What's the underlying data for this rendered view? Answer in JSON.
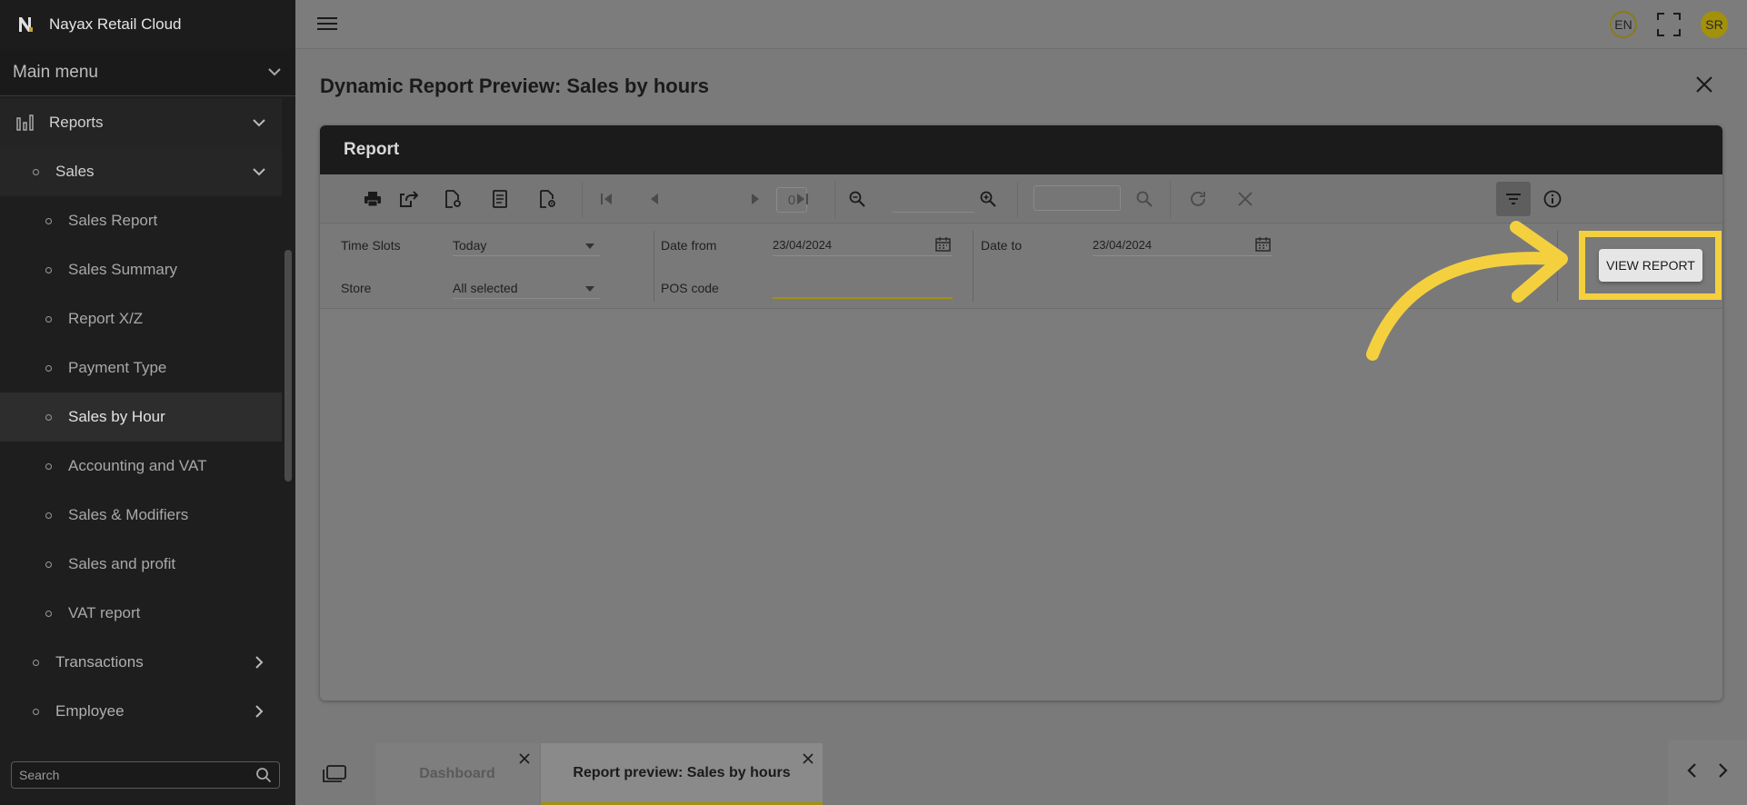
{
  "app": {
    "title": "Nayax Retail Cloud"
  },
  "sidebar": {
    "main_menu_label": "Main menu",
    "reports_label": "Reports",
    "sales_label": "Sales",
    "sales_items": [
      "Sales Report",
      "Sales Summary",
      "Report X/Z",
      "Payment Type",
      "Sales by Hour",
      "Accounting and VAT",
      "Sales & Modifiers",
      "Sales and profit",
      "VAT report"
    ],
    "active_item": "Sales by Hour",
    "transactions_label": "Transactions",
    "employee_label": "Employee",
    "search_placeholder": "Search"
  },
  "topbar": {
    "language": "EN",
    "user_initials": "SR"
  },
  "page": {
    "title": "Dynamic Report Preview: Sales by hours"
  },
  "report": {
    "header": "Report",
    "page_number": "0",
    "params": {
      "time_slots_label": "Time Slots",
      "time_slots_value": "Today",
      "store_label": "Store",
      "store_value": "All selected",
      "date_from_label": "Date from",
      "date_from_value": "23/04/2024",
      "date_to_label": "Date to",
      "date_to_value": "23/04/2024",
      "pos_code_label": "POS code",
      "pos_code_value": ""
    },
    "view_report_label": "VIEW REPORT"
  },
  "tabs": [
    {
      "label": "Dashboard"
    },
    {
      "label": "Report preview: Sales by hours"
    }
  ],
  "colors": {
    "accent": "#a3900b",
    "highlight": "#f4d03f",
    "sidebar_bg": "#1e1e1e"
  }
}
